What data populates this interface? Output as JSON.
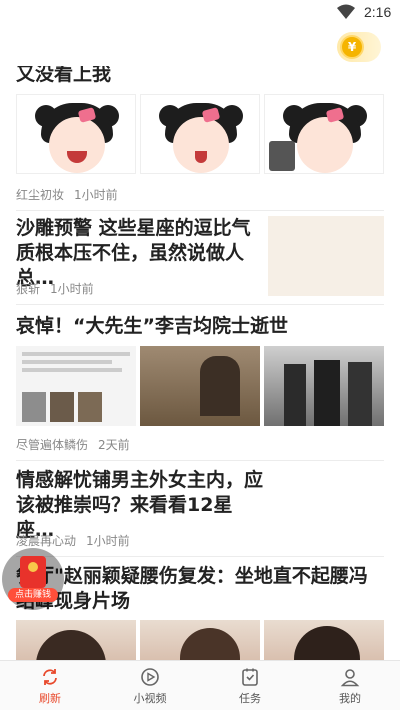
{
  "status_bar": {
    "time": "2:16",
    "wifi_icon": "wifi-icon"
  },
  "header": {
    "coin_symbol": "¥"
  },
  "feed": {
    "items": [
      {
        "title": "又没看上我",
        "author": "",
        "time": ""
      },
      {
        "title": "",
        "author": "红尘初妆",
        "time": "1小时前"
      },
      {
        "title": "沙雕预警 这些星座的逗比气质根本压不住，虽然说做人总…",
        "author": "狼斩",
        "time": "1小时前"
      },
      {
        "title": "哀悼！“大先生”李吉均院士逝世",
        "author": "尽管遍体鳞伤",
        "time": "2天前"
      },
      {
        "title": "情感解忧铺男主外女主内，应该被推崇吗？来看看12星座…",
        "author": "凌晨再心动",
        "time": "1小时前"
      },
      {
        "title": "餐厅\"赵丽颖疑腰伤复发：坐地直不起腰冯绍峰现身片场",
        "author": "",
        "time": ""
      }
    ]
  },
  "float_button": {
    "label": "点击赚钱"
  },
  "tabs": [
    {
      "label": "刷新",
      "icon": "refresh-icon",
      "active": true
    },
    {
      "label": "小视频",
      "icon": "play-icon",
      "active": false
    },
    {
      "label": "任务",
      "icon": "task-icon",
      "active": false
    },
    {
      "label": "我的",
      "icon": "user-icon",
      "active": false
    }
  ],
  "colors": {
    "accent": "#e8492c",
    "coin": "#f5b400"
  }
}
